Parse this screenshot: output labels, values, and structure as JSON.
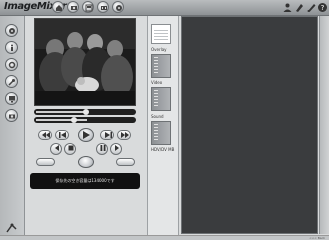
{
  "app": {
    "logo_text": "ImageMixer",
    "mode_buttons": [
      "home-mode",
      "capture-mode",
      "album-mode",
      "edit-mode",
      "output-mode",
      "web-mode"
    ],
    "tool_icons": [
      "user-icon",
      "tag-icon",
      "edit-icon",
      "help-icon"
    ]
  },
  "left_rail": {
    "icons": [
      "disc-icon",
      "info-icon",
      "settings-icon",
      "wrench-icon",
      "monitor-icon",
      "camera-icon"
    ],
    "bottom_icon": "exit-icon"
  },
  "player": {
    "status_message": "保存先の空き容量は134000です",
    "playback_progress": 0.48,
    "volume_level": 0.5
  },
  "strip": {
    "sections": [
      {
        "label": "Overlay",
        "value": ""
      },
      {
        "label": "Video",
        "value": ""
      },
      {
        "label": "Sound",
        "value": ""
      },
      {
        "label": "HDV/DV MB",
        "value": ""
      }
    ]
  },
  "footer": {
    "right_text": "<<< Back"
  }
}
